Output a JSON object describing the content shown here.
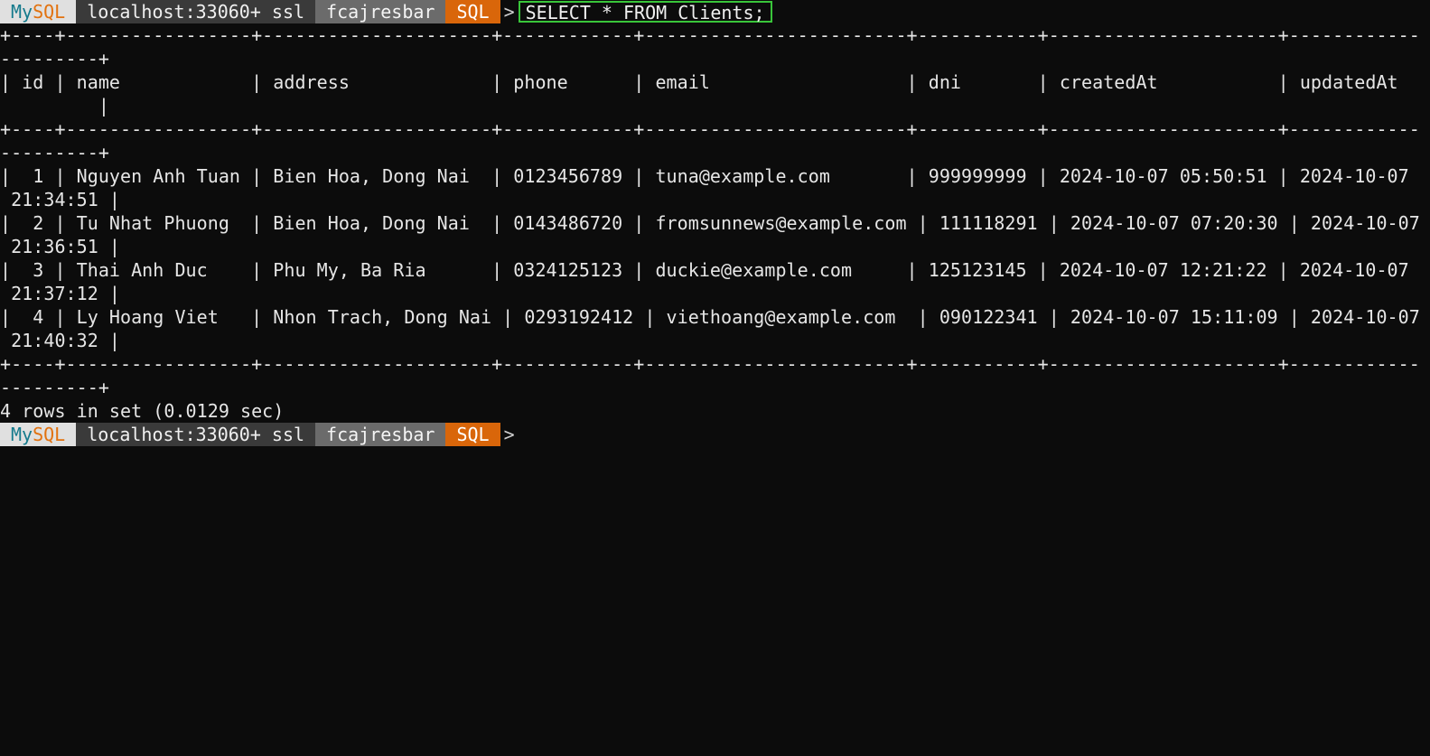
{
  "prompt": {
    "brand_my": "My",
    "brand_sql": "SQL",
    "host": "localhost:33060+ ssl",
    "schema": "fcajresbar",
    "mode": "SQL",
    "arrow": ">"
  },
  "command": "SELECT * FROM Clients;",
  "table_lines": [
    "+----+-----------------+---------------------+------------+------------------------+-----------+---------------------+------------",
    "---------+",
    "| id | name            | address             | phone      | email                  | dni       | createdAt           | updatedAt",
    "         |",
    "+----+-----------------+---------------------+------------+------------------------+-----------+---------------------+------------",
    "---------+",
    "|  1 | Nguyen Anh Tuan | Bien Hoa, Dong Nai  | 0123456789 | tuna@example.com       | 999999999 | 2024-10-07 05:50:51 | 2024-10-07",
    " 21:34:51 |",
    "|  2 | Tu Nhat Phuong  | Bien Hoa, Dong Nai  | 0143486720 | fromsunnews@example.com | 111118291 | 2024-10-07 07:20:30 | 2024-10-07",
    " 21:36:51 |",
    "|  3 | Thai Anh Duc    | Phu My, Ba Ria      | 0324125123 | duckie@example.com     | 125123145 | 2024-10-07 12:21:22 | 2024-10-07",
    " 21:37:12 |",
    "|  4 | Ly Hoang Viet   | Nhon Trach, Dong Nai | 0293192412 | viethoang@example.com  | 090122341 | 2024-10-07 15:11:09 | 2024-10-07",
    " 21:40:32 |",
    "+----+-----------------+---------------------+------------+------------------------+-----------+---------------------+------------",
    "---------+"
  ],
  "result_summary": "4 rows in set (0.0129 sec)"
}
